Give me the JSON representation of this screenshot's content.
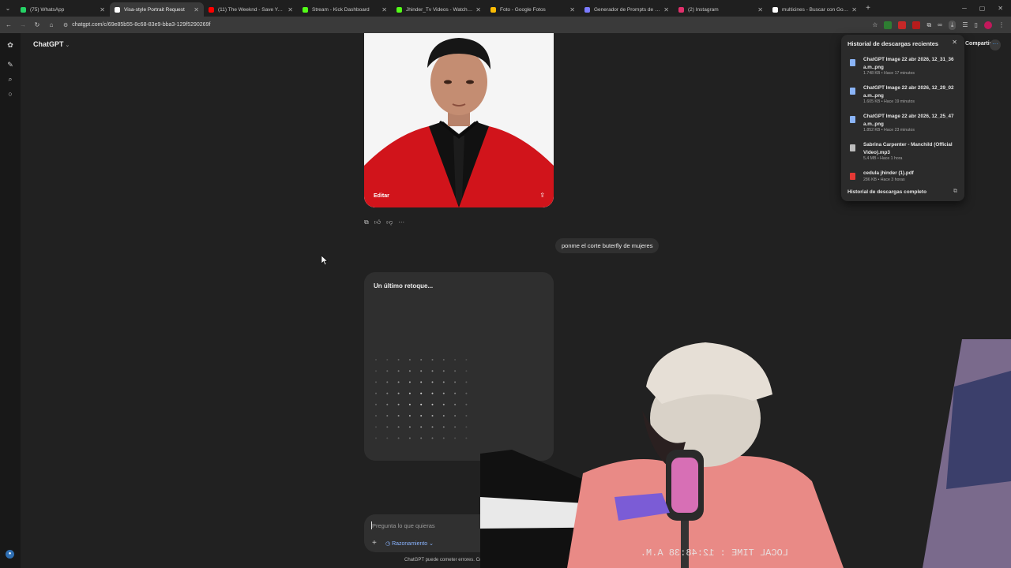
{
  "tabs": [
    {
      "title": "(75) WhatsApp",
      "color": "#25d366",
      "active": false
    },
    {
      "title": "Visa-style Portrait Request",
      "color": "#ffffff",
      "active": true
    },
    {
      "title": "(11) The Weeknd - Save Yo...",
      "color": "#ff0000",
      "active": false
    },
    {
      "title": "Stream - Kick Dashboard",
      "color": "#53fc18",
      "active": false
    },
    {
      "title": "Jhinder_Tv Videos - Watch On ...",
      "color": "#53fc18",
      "active": false
    },
    {
      "title": "Foto - Google Fotos",
      "color": "#fbbc04",
      "active": false
    },
    {
      "title": "Generador de Prompts de IA - ...",
      "color": "#7b7bff",
      "active": false
    },
    {
      "title": "(2) Instagram",
      "color": "#e1306c",
      "active": false
    },
    {
      "title": "multicines - Buscar con Google",
      "color": "#ffffff",
      "active": false
    }
  ],
  "browser": {
    "url": "chatgpt.com/c/69e85b55-8c68-83e9-bba3-129f5290269f"
  },
  "app": {
    "brand": "ChatGPT",
    "share_label": "Compartir"
  },
  "chat": {
    "image_edit_label": "Editar",
    "user_message": "ponme el corte  buterfly de mujeres",
    "generating_title": "Un último retoque...",
    "composer_placeholder": "Pregunta lo que quieras",
    "reasoning_label": "Razonamiento",
    "footer_note": "ChatGPT puede cometer errores. Co"
  },
  "downloads": {
    "title": "Historial de descargas recientes",
    "items": [
      {
        "name": "ChatGPT Image 22 abr 2026, 12_31_36 a.m..png",
        "meta": "1.748 KB • Hace 17 minutos",
        "type": "image"
      },
      {
        "name": "ChatGPT Image 22 abr 2026, 12_29_02 a.m..png",
        "meta": "1.605 KB • Hace 19 minutos",
        "type": "image"
      },
      {
        "name": "ChatGPT Image 22 abr 2026, 12_25_47 a.m..png",
        "meta": "1.852 KB • Hace 23 minutos",
        "type": "image"
      },
      {
        "name": "Sabrina Carpenter - Manchild (Official Video).mp3",
        "meta": "5,4 MB • Hace 1 hora",
        "type": "audio"
      },
      {
        "name": "cedula jhinder (1).pdf",
        "meta": "286 KB • Hace 3 horas",
        "type": "pdf"
      }
    ],
    "full_history_label": "Historial de descargas completo"
  },
  "overlay": {
    "clock_text": "LOCAL TIME : 12:48:38 A.M."
  }
}
